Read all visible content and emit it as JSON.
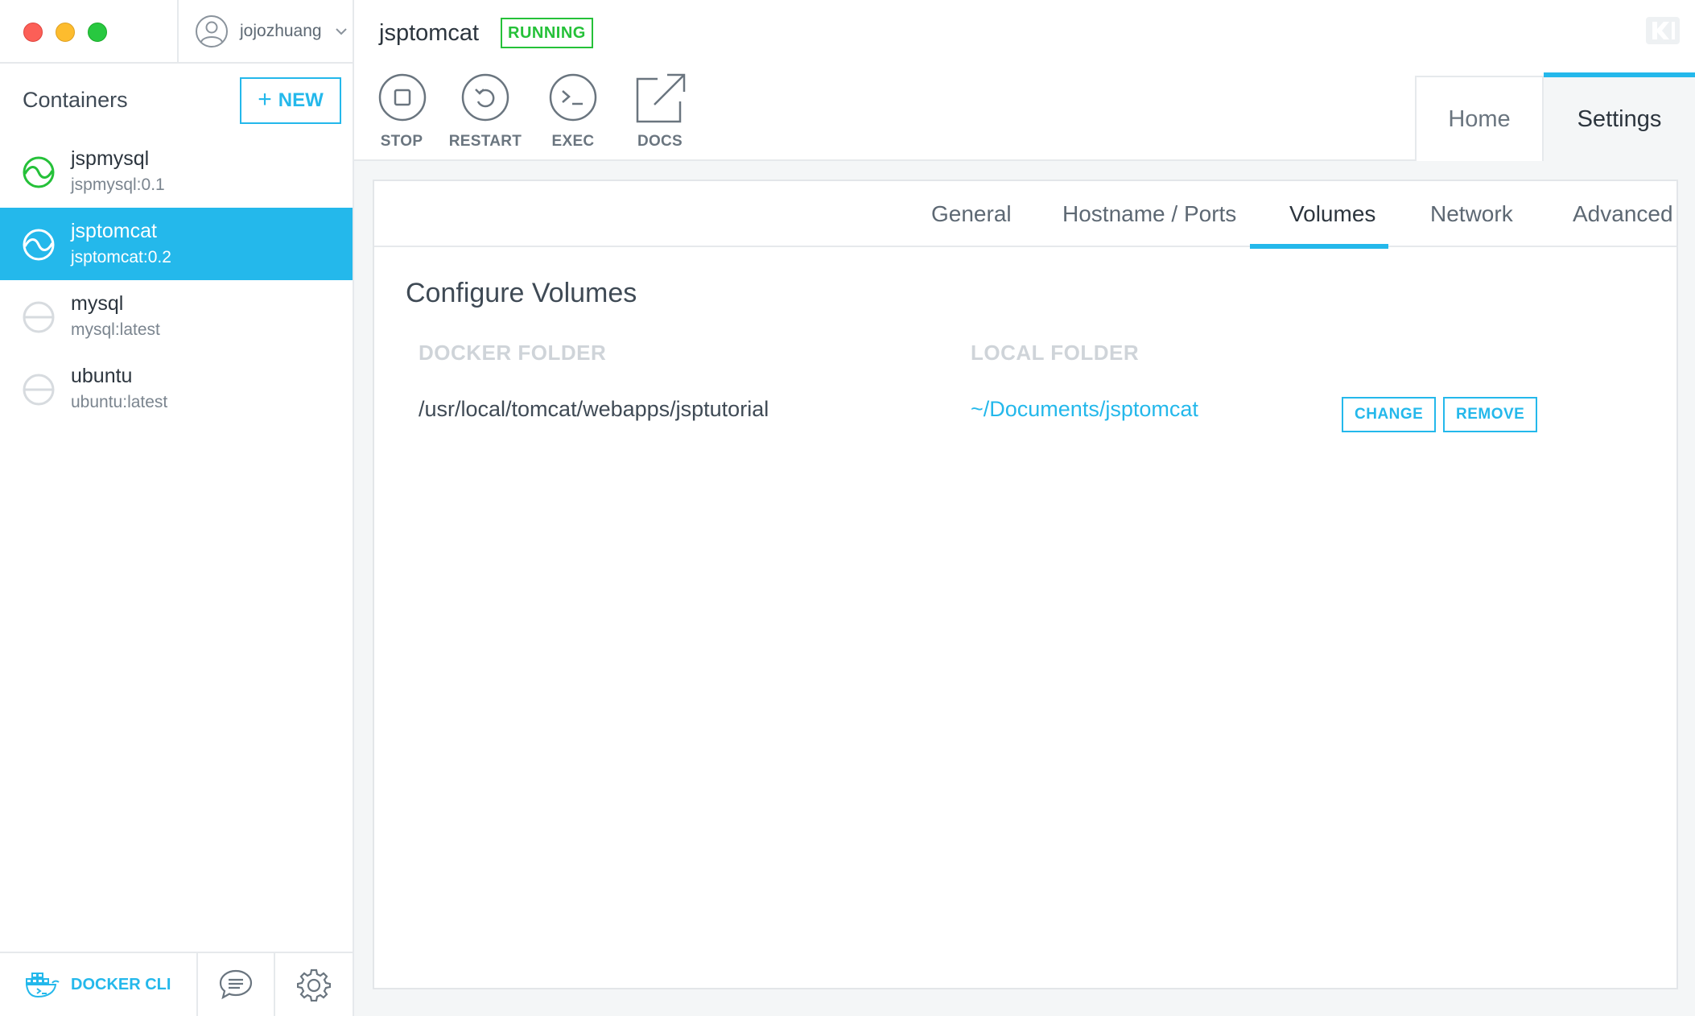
{
  "account": {
    "username": "jojozhuang"
  },
  "sidebar": {
    "containers_title": "Containers",
    "new_button": {
      "plus": "+",
      "label": "NEW"
    },
    "containers": [
      {
        "name": "jspmysql",
        "image": "jspmysql:0.1",
        "state": "running"
      },
      {
        "name": "jsptomcat",
        "image": "jsptomcat:0.2",
        "state": "running"
      },
      {
        "name": "mysql",
        "image": "mysql:latest",
        "state": "stopped"
      },
      {
        "name": "ubuntu",
        "image": "ubuntu:latest",
        "state": "stopped"
      }
    ],
    "footer": {
      "docker_cli_label": "DOCKER CLI"
    }
  },
  "header": {
    "container_name": "jsptomcat",
    "status_badge": "RUNNING",
    "actions": {
      "stop": "STOP",
      "restart": "RESTART",
      "exec": "EXEC",
      "docs": "DOCS"
    },
    "nav": {
      "home": "Home",
      "settings": "Settings"
    }
  },
  "settings": {
    "tabs": {
      "general": "General",
      "ports": "Hostname / Ports",
      "volumes": "Volumes",
      "network": "Network",
      "advanced": "Advanced"
    },
    "active_tab": "Volumes",
    "volumes": {
      "title": "Configure Volumes",
      "docker_folder_header": "DOCKER FOLDER",
      "local_folder_header": "LOCAL FOLDER",
      "rows": [
        {
          "docker_folder": "/usr/local/tomcat/webapps/jsptutorial",
          "local_folder": "~/Documents/jsptomcat",
          "change": "CHANGE",
          "remove": "REMOVE"
        }
      ]
    }
  },
  "colors": {
    "accent": "#24b8eb",
    "running_green": "#25c139",
    "stopped_gray": "#d7dbdf"
  }
}
